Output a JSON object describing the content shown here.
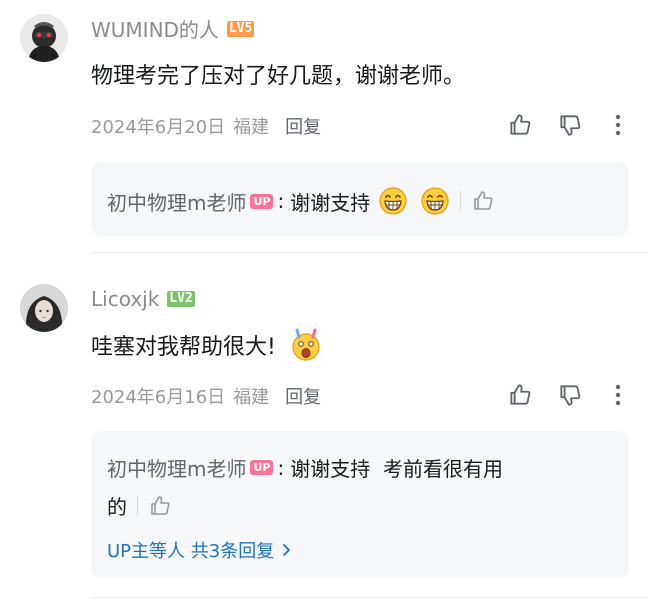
{
  "comments": [
    {
      "username": "WUMIND的人",
      "level": "LV5",
      "content": "物理考完了压对了好几题，谢谢老师。",
      "date": "2024年6月20日",
      "location": "福建",
      "reply_label": "回复",
      "up_reply": {
        "name": "初中物理m老师",
        "up_badge": "UP",
        "colon": ":",
        "text": "谢谢支持"
      }
    },
    {
      "username": "Licoxjk",
      "level": "LV2",
      "content": "哇塞对我帮助很大!",
      "date": "2024年6月16日",
      "location": "福建",
      "reply_label": "回复",
      "up_reply": {
        "name": "初中物理m老师",
        "up_badge": "UP",
        "colon": ":",
        "text_line1": "谢谢支持  考前看很有用",
        "text_line2": "的"
      },
      "more_replies": "UP主等人 共3条回复"
    }
  ],
  "colors": {
    "accent_link": "#1e72c8",
    "up_badge": "#fb7299",
    "lv5": "#ff9a4a",
    "lv2": "#7cc46a"
  },
  "icons": [
    "thumbs-up-icon",
    "thumbs-down-icon",
    "more-vertical-icon",
    "grin-emoji-icon",
    "shocked-emoji-icon",
    "chevron-right-icon"
  ]
}
